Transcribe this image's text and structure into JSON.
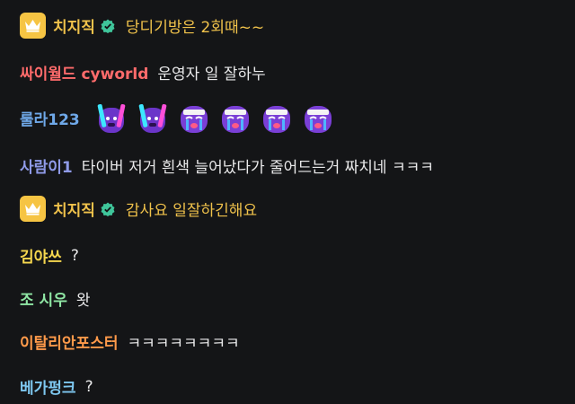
{
  "colors": {
    "background": "#141517",
    "streamer_name": "#f0c24b",
    "streamer_message": "#f0c24b",
    "verified_badge": "#3fc69b",
    "crown_badge": "#f6c443"
  },
  "icons": {
    "crown": "crown-icon",
    "verified": "verified-check-icon",
    "emote_glowstick": "glowstick-emote-icon",
    "emote_crying": "crying-emote-icon"
  },
  "messages": [
    {
      "user": "치지직",
      "text": "당디기방은 2회때~~",
      "name_color": "#f0c24b"
    },
    {
      "user": "싸이월드 cyworld",
      "text": "운영자 일 잘하누",
      "name_color": "#ff6b6b"
    },
    {
      "user": "룰라123",
      "text": "",
      "name_color": "#6fa8e8"
    },
    {
      "user": "사람이1",
      "text": "타이버 저거 흰색 늘어났다가 줄어드는거 짜치네 ㅋㅋㅋ",
      "name_color": "#8f9ae8"
    },
    {
      "user": "치지직",
      "text": "감사요 일잘하긴해요",
      "name_color": "#f0c24b"
    },
    {
      "user": "김야쓰",
      "text": "?",
      "name_color": "#f5d64e"
    },
    {
      "user": "조 시우",
      "text": "왓",
      "name_color": "#8fe6a4"
    },
    {
      "user": "이탈리안포스터",
      "text": "ㅋㅋㅋㅋㅋㅋㅋㅋ",
      "name_color": "#ff9a4a"
    },
    {
      "user": "베가펑크",
      "text": "?",
      "name_color": "#7ec8f0"
    }
  ]
}
